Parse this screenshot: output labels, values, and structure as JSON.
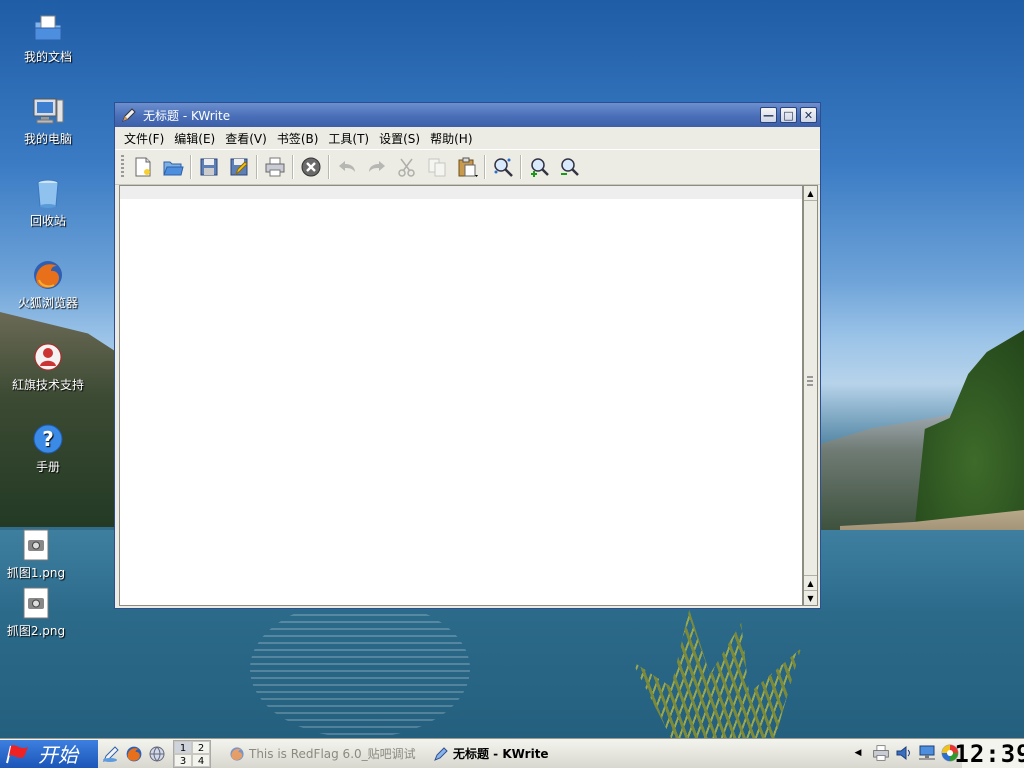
{
  "desktop": {
    "icons": [
      {
        "label": "我的文档",
        "icon": "documents-folder-icon"
      },
      {
        "label": "我的电脑",
        "icon": "computer-icon"
      },
      {
        "label": "回收站",
        "icon": "trash-icon"
      },
      {
        "label": "火狐浏览器",
        "icon": "firefox-icon"
      },
      {
        "label": "紅旗技术支持",
        "icon": "support-icon"
      },
      {
        "label": "手册",
        "icon": "help-icon"
      },
      {
        "label": "抓图1.png",
        "icon": "image-file-icon"
      },
      {
        "label": "抓图2.png",
        "icon": "image-file-icon"
      }
    ]
  },
  "window": {
    "title": "无标题 - KWrite",
    "menus": [
      "文件(F)",
      "编辑(E)",
      "查看(V)",
      "书签(B)",
      "工具(T)",
      "设置(S)",
      "帮助(H)"
    ],
    "toolbar": [
      {
        "name": "new-file",
        "enabled": true
      },
      {
        "name": "open-folder",
        "enabled": true
      },
      {
        "name": "save",
        "enabled": true
      },
      {
        "name": "save-as",
        "enabled": true
      },
      {
        "name": "print",
        "enabled": true
      },
      {
        "name": "close-document",
        "enabled": true
      },
      {
        "name": "undo",
        "enabled": false
      },
      {
        "name": "redo",
        "enabled": false
      },
      {
        "name": "cut",
        "enabled": false
      },
      {
        "name": "copy",
        "enabled": false
      },
      {
        "name": "paste",
        "enabled": true
      },
      {
        "name": "find",
        "enabled": true
      },
      {
        "name": "zoom-in",
        "enabled": true
      },
      {
        "name": "zoom-out",
        "enabled": true
      }
    ],
    "editor_text": ""
  },
  "taskbar": {
    "start_label": "开始",
    "pager": [
      "1",
      "2",
      "3",
      "4"
    ],
    "tasks": [
      {
        "label": "This is RedFlag 6.0_贴吧调试",
        "active": false
      },
      {
        "label": "无标题 - KWrite",
        "active": true
      }
    ],
    "clock": "12:39"
  },
  "colors": {
    "titlebar": "#4a6fb8",
    "start_button": "#1b56b8",
    "window_bg": "#ecece4"
  }
}
